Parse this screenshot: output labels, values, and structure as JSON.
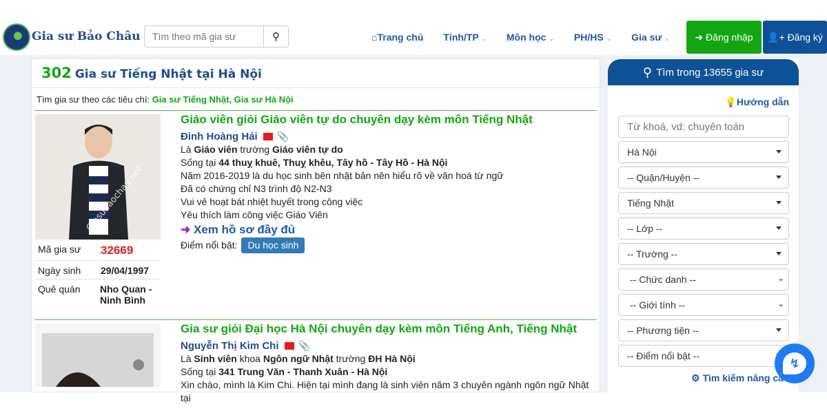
{
  "header": {
    "brand": "Gia sư Bảo Châu",
    "search_placeholder": "Tìm theo mã gia sư",
    "nav": [
      "Trang chủ",
      "Tỉnh/TP",
      "Môn học",
      "PH/HS",
      "Gia sư"
    ],
    "login": "Đăng nhập",
    "register": "Đăng ký",
    "colors": {
      "login": "#12a712",
      "register": "#0f5196"
    }
  },
  "main": {
    "count": "302",
    "title": "Gia sư Tiếng Nhật tại Hà Nội",
    "criteria_label": "Tìm gia sư theo các tiêu chí:",
    "criteria": "Gia sư Tiếng Nhật, Gia sư Hà Nội",
    "tutors": [
      {
        "headline": "Giáo viên giỏi Giáo viên tự do chuyên dạy kèm môn Tiếng Nhật",
        "name": "Đinh Hoàng Hải",
        "role_pre": "Là ",
        "role": "Giáo viên",
        "school_pre": " trường ",
        "school": "Giáo viên tự do",
        "live_pre": "Sống tại ",
        "address": "44 thuỵ khuê, Thuỵ khêu, Tây hồ - Tây Hồ - Hà Nội",
        "desc": [
          "Năm 2016-2019 là du học sinh bên nhật bản nên hiểu rõ về văn hoá từ ngữ",
          "Đã có chứng chỉ N3 trình độ N2-N3",
          "Vui vẻ hoạt bát nhiệt huyết trong công việc",
          "Yêu thích làm công việc Giáo Viên"
        ],
        "more": "Xem hồ sơ đầy đủ",
        "highlight_label": "Điểm nổi bật:",
        "highlight": "Du học sinh",
        "watermark": "Giasubaochau.net",
        "id_label": "Mã gia sư",
        "id": "32669",
        "dob_label": "Ngày sinh",
        "dob": "29/04/1997",
        "home_label": "Quê quán",
        "home": "Nho Quan - Ninh Bình"
      },
      {
        "headline": "Gia sư giỏi Đại học Hà Nội chuyên dạy kèm môn Tiếng Anh, Tiếng Nhật",
        "name": "Nguyễn Thị Kim Chi",
        "role_pre": "Là ",
        "role": "Sinh viên",
        "faculty_pre": " khoa ",
        "faculty": "Ngôn ngữ Nhật",
        "school_pre": " trường ",
        "school": "ĐH Hà Nội",
        "live_pre": "Sống tại ",
        "address": "341 Trung Văn - Thanh Xuân - Hà Nội",
        "desc": [
          "Xin chào, mình là Kim Chi. Hiện tại mình đang là sinh viên năm 3 chuyên ngành ngôn ngữ Nhật tại"
        ]
      }
    ]
  },
  "sidebar": {
    "title": "Tìm trong 13655 gia sư",
    "guide": "Hướng dẫn",
    "keyword_placeholder": "Từ khoá, vd: chuyên toán",
    "selects": [
      "Hà Nội",
      "-- Quận/Huyện --",
      "Tiếng Nhật",
      "-- Lớp --",
      "-- Trường --",
      "-- Chức danh --",
      "-- Giới tính --",
      "-- Phương tiện --",
      "-- Điểm nổi bật --"
    ],
    "advanced": "Tìm kiếm nâng cao"
  }
}
